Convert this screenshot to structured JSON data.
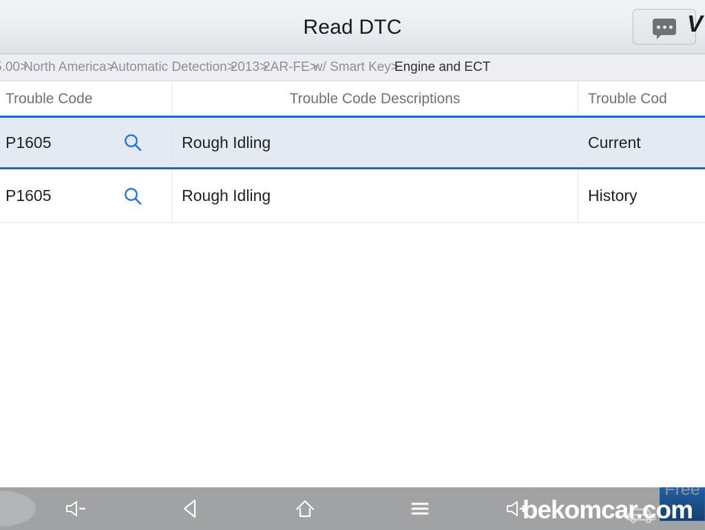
{
  "titlebar": {
    "title": "Read DTC",
    "chat_button_label": "chat",
    "brand": "V"
  },
  "breadcrumb": {
    "separator": ">",
    "items": [
      {
        "label": "5.00",
        "active": false
      },
      {
        "label": "North America",
        "active": false
      },
      {
        "label": "Automatic Detection",
        "active": false
      },
      {
        "label": "2013",
        "active": false
      },
      {
        "label": "2AR-FE",
        "active": false
      },
      {
        "label": "w/ Smart Key",
        "active": false
      },
      {
        "label": "Engine and ECT",
        "active": true
      }
    ]
  },
  "table": {
    "columns": [
      {
        "key": "code",
        "label": "Trouble Code"
      },
      {
        "key": "desc",
        "label": "Trouble Code Descriptions"
      },
      {
        "key": "status",
        "label": "Trouble Cod"
      }
    ],
    "rows": [
      {
        "code": "P1605",
        "desc": "Rough Idling",
        "status": "Current",
        "selected": true
      },
      {
        "code": "P1605",
        "desc": "Rough Idling",
        "status": "History",
        "selected": false
      }
    ]
  },
  "navbar": {
    "buttons": [
      {
        "name": "volume-down",
        "label": "Volume down"
      },
      {
        "name": "back",
        "label": "Back"
      },
      {
        "name": "home",
        "label": "Home"
      },
      {
        "name": "menu",
        "label": "Menu"
      },
      {
        "name": "volume-up",
        "label": "Volume up"
      }
    ]
  },
  "watermark": {
    "text": "bekomcar.com",
    "badge": "Free"
  },
  "colors": {
    "accent_blue": "#1763cf",
    "selected_row": "#e5e9f1",
    "titlebar": "#eceef1",
    "breadcrumb_text": "#8b8f98",
    "navbar": "#a0a2a4",
    "badge_blue": "#1b5391"
  }
}
